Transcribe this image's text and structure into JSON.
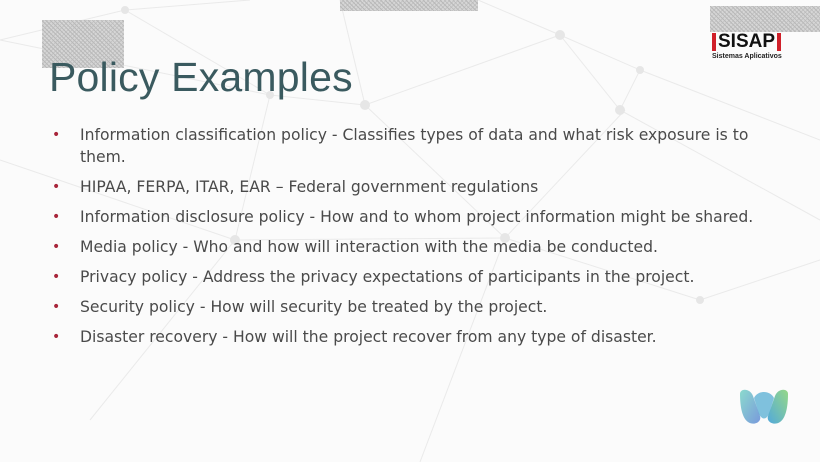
{
  "slide": {
    "title": "Policy Examples",
    "logo": {
      "name": "SISAP",
      "tagline": "Sistemas Aplicativos"
    },
    "bullet_marker": "•",
    "bullets": [
      "Information classification policy - Classifies types of data and what risk exposure is to them.",
      "HIPAA, FERPA, ITAR, EAR – Federal government regulations",
      "Information disclosure policy - How and to whom project information might be shared.",
      "Media policy - Who and how will interaction with the media be conducted.",
      "Privacy policy - Address the privacy expectations of participants in the project.",
      "Security policy - How will security be treated by the project.",
      "Disaster recovery - How will the project recover from any type of disaster."
    ]
  },
  "colors": {
    "title": "#3a5a5f",
    "bullet_marker": "#a8253a",
    "body_text": "#4a4a4a",
    "logo_accent": "#d0202a"
  },
  "icons": {
    "corner": "webex-style-overlap-logo-icon",
    "background": "network-lines-pattern"
  }
}
